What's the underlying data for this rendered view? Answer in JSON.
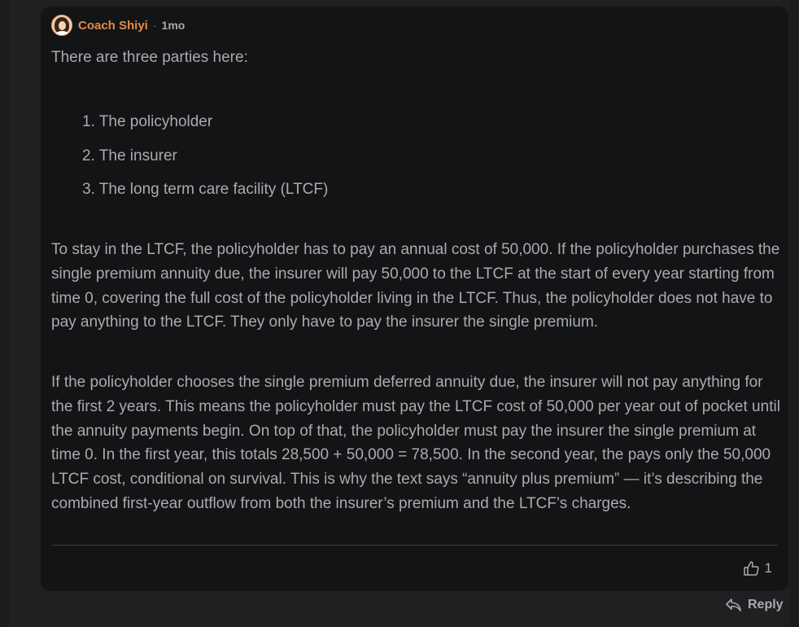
{
  "comment": {
    "author": "Coach Shiyi",
    "separator": "·",
    "time": "1mo",
    "intro": "There are three parties here:",
    "parties": [
      "1. The policyholder",
      "2. The insurer",
      "3. The long term care facility (LTCF)"
    ],
    "paragraph1": "To stay in the LTCF, the policyholder has to pay an annual cost of 50,000. If the policyholder purchases the single premium annuity due, the insurer will pay 50,000 to the LTCF at the start of every year starting from time 0, covering the full cost of the policyholder living in the LTCF. Thus, the policyholder does not have to pay anything to the LTCF. They only have to pay the insurer the single premium.",
    "paragraph2": "If the policyholder chooses the single premium deferred annuity due, the insurer will not pay anything for the first 2 years. This means the policyholder must pay the LTCF cost of 50,000 per year out of pocket until the annuity payments begin. On top of that, the policyholder must pay the insurer the single premium at time 0. In the first year, this totals 28,500 + 50,000 = 78,500. In the second year, the pays only the 50,000 LTCF cost, conditional on survival. This is why the text says “annuity plus premium” — it’s describing the combined first-year outflow from both the insurer’s premium and the LTCF’s charges.",
    "like_count": "1"
  },
  "actions": {
    "reply_label": "Reply"
  },
  "colors": {
    "author": "#e28a4a",
    "text": "#a9abae",
    "card_bg": "#131415"
  },
  "icons": {
    "like": "thumbs-up-icon",
    "reply": "reply-arrow-icon"
  }
}
